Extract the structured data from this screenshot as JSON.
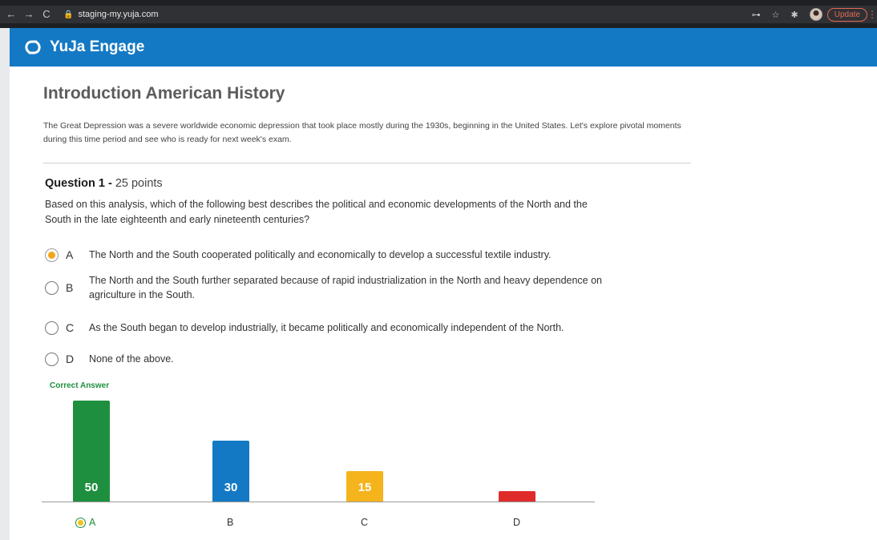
{
  "browser": {
    "url": "staging-my.yuja.com",
    "update_label": "Update",
    "icons": [
      "back-icon",
      "forward-icon",
      "reload-icon",
      "lock-icon",
      "key-icon",
      "star-icon",
      "extensions-icon",
      "avatar",
      "menu-icon"
    ]
  },
  "app": {
    "name": "YuJa Engage",
    "header_color": "#1479c4"
  },
  "course": {
    "title": "Introduction American History",
    "description": "The Great Depression was a severe worldwide economic depression that took place mostly during the 1930s, beginning in the United States. Let's explore pivotal moments during this time period and see who is ready for next week's exam."
  },
  "question": {
    "label": "Question 1 -",
    "points": "25 points",
    "text": "Based on this analysis, which of the following best describes the political and economic developments of the North and the South in the late eighteenth and early nineteenth centuries?",
    "options": [
      {
        "letter": "A",
        "text": "The North and the South cooperated politically and economically to develop a successful textile industry.",
        "selected": true
      },
      {
        "letter": "B",
        "text": "The North and the South further separated because of rapid industrialization in the North and heavy dependence on agriculture in the South.",
        "selected": false
      },
      {
        "letter": "C",
        "text": "As the South began to develop industrially, it became politically and economically independent of the North.",
        "selected": false
      },
      {
        "letter": "D",
        "text": "None of the above.",
        "selected": false
      }
    ],
    "correct_answer_label": "Correct Answer"
  },
  "chart_data": {
    "type": "bar",
    "categories": [
      "A",
      "B",
      "C",
      "D"
    ],
    "values": [
      50,
      30,
      15,
      5
    ],
    "colors": [
      "#1e8f3e",
      "#1479c4",
      "#f5b31c",
      "#e02b2b"
    ],
    "correct_category": "A"
  }
}
